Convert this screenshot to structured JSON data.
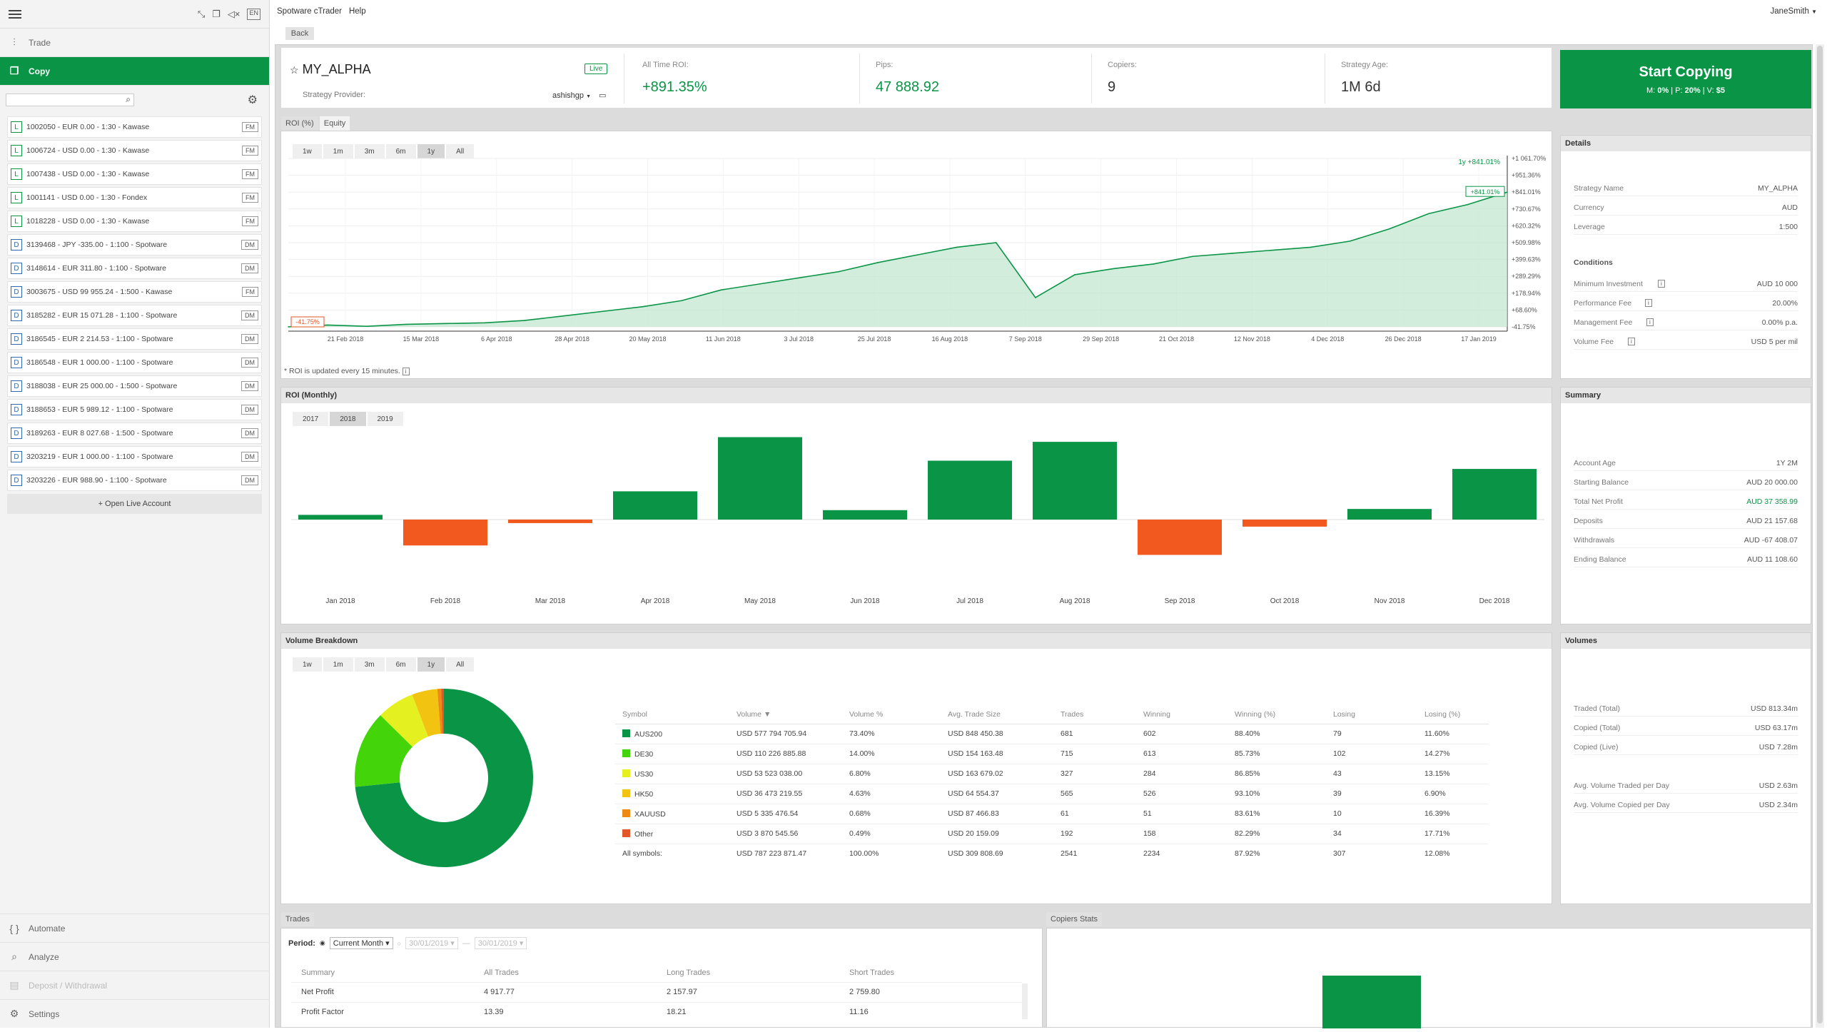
{
  "app": {
    "menu": [
      "Spotware cTrader",
      "Help"
    ],
    "user": "JaneSmith",
    "back": "Back"
  },
  "nav": {
    "trade": "Trade",
    "copy": "Copy",
    "automate": "Automate",
    "analyze": "Analyze",
    "deposit": "Deposit / Withdrawal",
    "settings": "Settings",
    "open_live": "+ Open Live Account"
  },
  "accounts": [
    {
      "badge": "L",
      "label": "1002050 - EUR 0.00 - 1:30 - Kawase",
      "tag": "FM"
    },
    {
      "badge": "L",
      "label": "1006724 - USD 0.00 - 1:30 - Kawase",
      "tag": "FM"
    },
    {
      "badge": "L",
      "label": "1007438 - USD 0.00 - 1:30 - Kawase",
      "tag": "FM"
    },
    {
      "badge": "L",
      "label": "1001141 - USD 0.00 - 1:30 - Fondex",
      "tag": "FM"
    },
    {
      "badge": "L",
      "label": "1018228 - USD 0.00 - 1:30 - Kawase",
      "tag": "FM"
    },
    {
      "badge": "D",
      "label": "3139468 - JPY -335.00 - 1:100 - Spotware",
      "tag": "DM"
    },
    {
      "badge": "D",
      "label": "3148614 - EUR 311.80 - 1:100 - Spotware",
      "tag": "DM"
    },
    {
      "badge": "D",
      "label": "3003675 - USD 99 955.24 - 1:500 - Kawase",
      "tag": "FM"
    },
    {
      "badge": "D",
      "label": "3185282 - EUR 15 071.28 - 1:100 - Spotware",
      "tag": "DM"
    },
    {
      "badge": "D",
      "label": "3186545 - EUR 2 214.53 - 1:100 - Spotware",
      "tag": "DM"
    },
    {
      "badge": "D",
      "label": "3186548 - EUR 1 000.00 - 1:100 - Spotware",
      "tag": "DM"
    },
    {
      "badge": "D",
      "label": "3188038 - EUR 25 000.00 - 1:500 - Spotware",
      "tag": "DM"
    },
    {
      "badge": "D",
      "label": "3188653 - EUR 5 989.12 - 1:100 - Spotware",
      "tag": "DM"
    },
    {
      "badge": "D",
      "label": "3189263 - EUR 8 027.68 - 1:500 - Spotware",
      "tag": "DM"
    },
    {
      "badge": "D",
      "label": "3203219 - EUR 1 000.00 - 1:100 - Spotware",
      "tag": "DM"
    },
    {
      "badge": "D",
      "label": "3203226 - EUR 988.90 - 1:100 - Spotware",
      "tag": "DM"
    }
  ],
  "strategy": {
    "name": "MY_ALPHA",
    "status": "Live",
    "provider_label": "Strategy Provider:",
    "provider": "ashishgp",
    "stats": [
      {
        "label": "All Time ROI:",
        "value": "+891.35%"
      },
      {
        "label": "Pips:",
        "value": "47 888.92"
      },
      {
        "label": "Copiers:",
        "value": "9"
      },
      {
        "label": "Strategy Age:",
        "value": "1M 6d"
      }
    ],
    "start": {
      "title": "Start Copying",
      "m": "0%",
      "p": "20%",
      "v": "$5"
    }
  },
  "roi": {
    "tabs": [
      "ROI (%)",
      "Equity"
    ],
    "periods": [
      "1w",
      "1m",
      "3m",
      "6m",
      "1y",
      "All"
    ],
    "active": "1y",
    "note": "* ROI is updated every 15 minutes.",
    "legend": "1y +841.01%",
    "last": "+841.01%",
    "first": "-41.75%",
    "yticks": [
      "+1 061.70%",
      "+951.36%",
      "+841.01%",
      "+730.67%",
      "+620.32%",
      "+509.98%",
      "+399.63%",
      "+289.29%",
      "+178.94%",
      "+68.60%",
      "-41.75%"
    ],
    "xticks": [
      "21 Feb 2018",
      "15 Mar 2018",
      "6 Apr 2018",
      "28 Apr 2018",
      "20 May 2018",
      "11 Jun 2018",
      "3 Jul 2018",
      "25 Jul 2018",
      "16 Aug 2018",
      "7 Sep 2018",
      "29 Sep 2018",
      "21 Oct 2018",
      "12 Nov 2018",
      "4 Dec 2018",
      "26 Dec 2018",
      "17 Jan 2019"
    ]
  },
  "monthly": {
    "title": "ROI (Monthly)",
    "years": [
      "2017",
      "2018",
      "2019"
    ],
    "active": "2018"
  },
  "details": {
    "title": "Details",
    "rows": [
      {
        "k": "Strategy Name",
        "v": "MY_ALPHA"
      },
      {
        "k": "Currency",
        "v": "AUD"
      },
      {
        "k": "Leverage",
        "v": "1:500"
      }
    ],
    "conditions_title": "Conditions",
    "conditions": [
      {
        "k": "Minimum Investment",
        "v": "AUD 10 000"
      },
      {
        "k": "Performance Fee",
        "v": "20.00%"
      },
      {
        "k": "Management Fee",
        "v": "0.00% p.a."
      },
      {
        "k": "Volume Fee",
        "v": "USD 5 per mil"
      }
    ]
  },
  "summary": {
    "title": "Summary",
    "rows": [
      {
        "k": "Account Age",
        "v": "1Y 2M"
      },
      {
        "k": "Starting Balance",
        "v": "AUD 20 000.00"
      },
      {
        "k": "Total Net Profit",
        "v": "AUD 37 358.99"
      },
      {
        "k": "Deposits",
        "v": "AUD 21 157.68"
      },
      {
        "k": "Withdrawals",
        "v": "AUD -67 408.07"
      },
      {
        "k": "Ending Balance",
        "v": "AUD 11 108.60"
      }
    ]
  },
  "volume": {
    "title": "Volume Breakdown",
    "periods": [
      "1w",
      "1m",
      "3m",
      "6m",
      "1y",
      "All"
    ],
    "columns": [
      "Symbol",
      "Volume ▼",
      "Volume %",
      "Avg. Trade Size",
      "Trades",
      "Winning",
      "Winning (%)",
      "Losing",
      "Losing (%)"
    ],
    "rows": [
      {
        "color": "#0a9446",
        "cells": [
          "AUS200",
          "USD 577 794 705.94",
          "73.40%",
          "USD 848 450.38",
          "681",
          "602",
          "88.40%",
          "79",
          "11.60%"
        ]
      },
      {
        "color": "#44d40a",
        "cells": [
          "DE30",
          "USD 110 226 885.88",
          "14.00%",
          "USD 154 163.48",
          "715",
          "613",
          "85.73%",
          "102",
          "14.27%"
        ]
      },
      {
        "color": "#e4f020",
        "cells": [
          "US30",
          "USD 53 523 038.00",
          "6.80%",
          "USD 163 679.02",
          "327",
          "284",
          "86.85%",
          "43",
          "13.15%"
        ]
      },
      {
        "color": "#f2c311",
        "cells": [
          "HK50",
          "USD 36 473 219.55",
          "4.63%",
          "USD 64 554.37",
          "565",
          "526",
          "93.10%",
          "39",
          "6.90%"
        ]
      },
      {
        "color": "#ee8a12",
        "cells": [
          "XAUUSD",
          "USD 5 335 476.54",
          "0.68%",
          "USD 87 466.83",
          "61",
          "51",
          "83.61%",
          "10",
          "16.39%"
        ]
      },
      {
        "color": "#e2562a",
        "cells": [
          "Other",
          "USD 3 870 545.56",
          "0.49%",
          "USD 20 159.09",
          "192",
          "158",
          "82.29%",
          "34",
          "17.71%"
        ]
      }
    ],
    "total": [
      "All symbols:",
      "USD 787 223 871.47",
      "100.00%",
      "USD 309 808.69",
      "2541",
      "2234",
      "87.92%",
      "307",
      "12.08%"
    ]
  },
  "volumes": {
    "title": "Volumes",
    "rows": [
      {
        "k": "Traded (Total)",
        "v": "USD 813.34m"
      },
      {
        "k": "Copied (Total)",
        "v": "USD 63.17m"
      },
      {
        "k": "Copied (Live)",
        "v": "USD 7.28m"
      },
      {
        "k": "Avg. Volume Traded per Day",
        "v": "USD 2.63m"
      },
      {
        "k": "Avg. Volume Copied per Day",
        "v": "USD 2.34m"
      }
    ]
  },
  "trades": {
    "tab": "Trades",
    "copiers_tab": "Copiers Stats",
    "period_label": "Period:",
    "period": "Current Month",
    "from": "30/01/2019",
    "to": "30/01/2019",
    "columns": [
      "Summary",
      "All Trades",
      "Long Trades",
      "Short Trades"
    ],
    "rows": [
      [
        "Net Profit",
        "4 917.77",
        "2 157.97",
        "2 759.80"
      ],
      [
        "Profit Factor",
        "13.39",
        "18.21",
        "11.16"
      ]
    ]
  },
  "chart_data": [
    {
      "type": "area",
      "title": "ROI (%)",
      "series": [
        {
          "name": "1y",
          "values": [
            -41.75,
            -30,
            -38,
            -25,
            -20,
            -15,
            0,
            30,
            60,
            90,
            130,
            200,
            240,
            280,
            320,
            380,
            430,
            480,
            510,
            150,
            300,
            340,
            370,
            420,
            440,
            460,
            480,
            520,
            600,
            700,
            760,
            841.01
          ]
        }
      ],
      "ylim": [
        -41.75,
        1061.7
      ],
      "x": [
        "21 Feb 2018",
        "15 Mar 2018",
        "6 Apr 2018",
        "28 Apr 2018",
        "20 May 2018",
        "11 Jun 2018",
        "3 Jul 2018",
        "25 Jul 2018",
        "16 Aug 2018",
        "7 Sep 2018",
        "29 Sep 2018",
        "21 Oct 2018",
        "12 Nov 2018",
        "4 Dec 2018",
        "26 Dec 2018",
        "17 Jan 2019"
      ]
    },
    {
      "type": "bar",
      "title": "ROI (Monthly)",
      "categories": [
        "Jan 2018",
        "Feb 2018",
        "Mar 2018",
        "Apr 2018",
        "May 2018",
        "Jun 2018",
        "Jul 2018",
        "Aug 2018",
        "Sep 2018",
        "Oct 2018",
        "Nov 2018",
        "Dec 2018"
      ],
      "values": [
        2,
        -11,
        -1.5,
        12,
        35,
        4,
        25,
        33,
        -15,
        -3,
        4.5,
        21.5
      ]
    },
    {
      "type": "pie",
      "title": "Volume Breakdown",
      "categories": [
        "AUS200",
        "DE30",
        "US30",
        "HK50",
        "XAUUSD",
        "Other"
      ],
      "values": [
        73.4,
        14.0,
        6.8,
        4.63,
        0.68,
        0.49
      ]
    },
    {
      "type": "bar",
      "title": "Copiers Stats",
      "categories": [
        ""
      ],
      "values": [
        1
      ]
    }
  ]
}
